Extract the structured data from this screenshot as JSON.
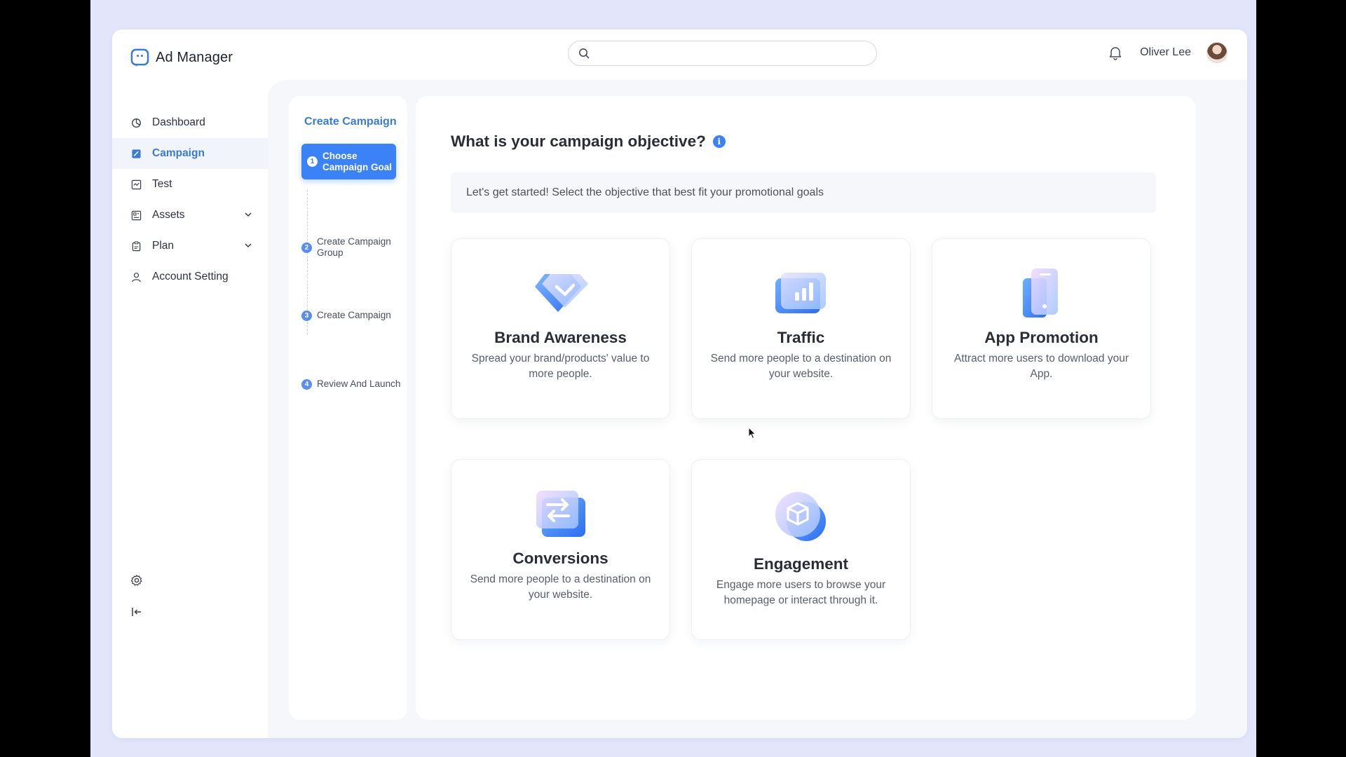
{
  "app": {
    "title": "Ad Manager",
    "brand_color": "#3a7bd5",
    "accent": "#3a82f6"
  },
  "header": {
    "search_placeholder": "",
    "user_name": "Oliver Lee"
  },
  "sidebar": {
    "items": [
      {
        "label": "Dashboard",
        "icon": "dashboard-icon",
        "active": false
      },
      {
        "label": "Campaign",
        "icon": "campaign-icon",
        "active": true
      },
      {
        "label": "Test",
        "icon": "test-icon",
        "active": false
      },
      {
        "label": "Assets",
        "icon": "assets-icon",
        "active": false,
        "expandable": true
      },
      {
        "label": "Plan",
        "icon": "plan-icon",
        "active": false,
        "expandable": true
      },
      {
        "label": "Account Setting",
        "icon": "user-icon",
        "active": false
      }
    ]
  },
  "steps": {
    "title": "Create Campaign",
    "items": [
      {
        "num": "1",
        "label": "Choose Campaign Goal",
        "active": true
      },
      {
        "num": "2",
        "label": "Create Campaign Group",
        "active": false
      },
      {
        "num": "3",
        "label": "Create Campaign",
        "active": false
      },
      {
        "num": "4",
        "label": "Review And Launch",
        "active": false
      }
    ]
  },
  "main": {
    "heading": "What is your campaign objective?",
    "info": "i",
    "subtitle": "Let's get started! Select the objective that best fit your promotional goals",
    "cards": [
      {
        "title": "Brand Awareness",
        "desc": "Spread your brand/products' value to more people.",
        "icon": "diamond-icon"
      },
      {
        "title": "Traffic",
        "desc": "Send more people to a destination on your website.",
        "icon": "bar-chart-icon"
      },
      {
        "title": "App Promotion",
        "desc": "Attract more users to download your App.",
        "icon": "phone-icon"
      },
      {
        "title": "Conversions",
        "desc": "Send more people to a destination on your website.",
        "icon": "swap-arrows-icon"
      },
      {
        "title": "Engagement",
        "desc": "Engage more users to browse your homepage or interact through it.",
        "icon": "cube-icon"
      }
    ]
  }
}
